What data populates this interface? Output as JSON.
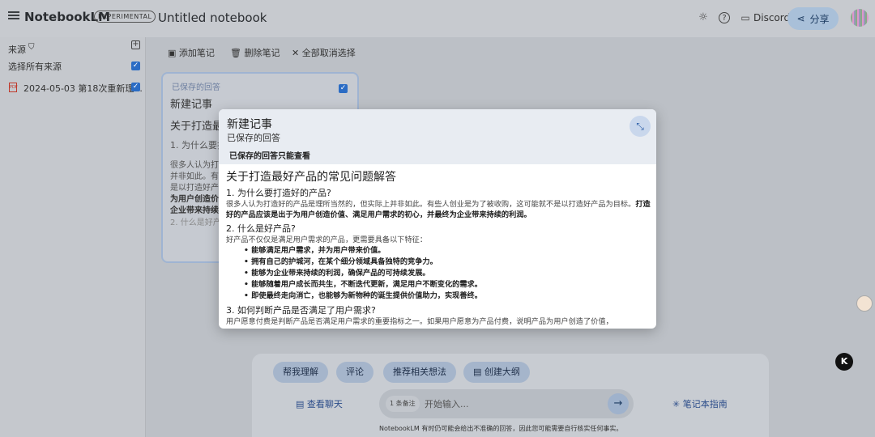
{
  "header": {
    "brand": "NotebookLM",
    "badge": "EXPERIMENTAL",
    "notebook_title": "Untitled notebook",
    "discord_label": "Discord",
    "share_label": "分享"
  },
  "sidebar": {
    "sources_label": "来源",
    "select_all_label": "选择所有来源",
    "source_item": "2024-05-03 第18次重新理..."
  },
  "toolbar": {
    "add_note": "添加笔记",
    "delete_note": "删除笔记",
    "deselect_all": "全部取消选择"
  },
  "note_card": {
    "saved_label": "已保存的回答",
    "title": "新建记事",
    "heading": "关于打造最",
    "q1": "1. 为什么要打",
    "p1": "很多人认为打",
    "p2": "并非如此。有",
    "p3": "是以打造好产",
    "p4": "为用户创造价",
    "p5": "企业带来持续",
    "q2": "2. 什么是好产"
  },
  "modal": {
    "title": "新建记事",
    "subtitle": "已保存的回答",
    "readonly_note": "已保存的回答只能查看",
    "heading": "关于打造最好产品的常见问题解答",
    "q1": "1. 为什么要打造好的产品?",
    "a1_plain": "很多人认为打造好的产品是理所当然的，但实际上并非如此。有些人创业是为了被收购，这可能就不是以打造好产品为目标。",
    "a1_bold": "打造好的产品应该是出于为用户创造价值、满足用户需求的初心，并最终为企业带来持续的利润。",
    "q2": "2. 什么是好产品?",
    "a2_intro": "好产品不仅仅是满足用户需求的产品，更需要具备以下特征：",
    "bullets": [
      "能够满足用户需求，并为用户带来价值。",
      "拥有自己的护城河，在某个细分领域具备独特的竞争力。",
      "能够为企业带来持续的利润，确保产品的可持续发展。",
      "能够随着用户成长而共生，不断迭代更新，满足用户不断变化的需求。",
      "即使最终走向消亡，也能够为新物种的诞生提供价值助力，实现善终。"
    ],
    "q3": "3. 如何判断产品是否满足了用户需求?",
    "a3": "用户愿意付费是判断产品是否满足用户需求的重要指标之一。如果用户愿意为产品付费，说明产品为用户创造了价值，"
  },
  "chat": {
    "chips": [
      "帮我理解",
      "评论",
      "推荐相关想法",
      "创建大纲"
    ],
    "view_chat": "查看聊天",
    "notebook_guide": "笔记本指南",
    "source_count": "1 条备注",
    "placeholder": "开始输入...",
    "disclaimer": "NotebookLM 有时仍可能会给出不准确的回答，因此您可能需要自行核实任何事实。"
  },
  "colors": {
    "accent": "#2b6cc4",
    "share_bg": "#a9c0d9",
    "modal_header": "#e8ecf2"
  }
}
